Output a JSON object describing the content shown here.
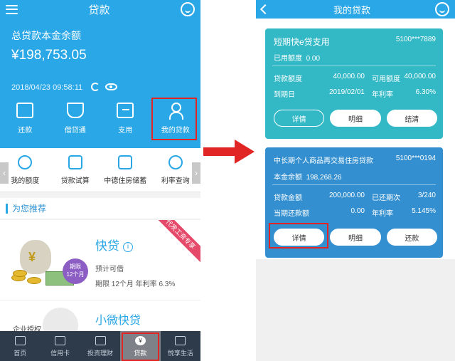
{
  "left": {
    "header": {
      "title": "贷款"
    },
    "summary": {
      "label": "总贷款本金余额",
      "amount": "¥198,753.05",
      "timestamp": "2018/04/23 09:58:11"
    },
    "actions": [
      {
        "label": "还款",
        "icon": "repay-icon"
      },
      {
        "label": "借贷通",
        "icon": "hand-money-icon"
      },
      {
        "label": "支用",
        "icon": "withdraw-icon"
      },
      {
        "label": "我的贷款",
        "icon": "user-loan-icon"
      }
    ],
    "quick": [
      {
        "label": "我的额度"
      },
      {
        "label": "贷款试算"
      },
      {
        "label": "中德住房储蓄"
      },
      {
        "label": "利率查询"
      }
    ],
    "recommend": {
      "title": "为您推荐"
    },
    "product1": {
      "title": "快贷",
      "subtitle": "预计可借",
      "term": "期限 12个月  年利率 6.3%",
      "badge_line1": "期限",
      "badge_line2": "12个月",
      "ribbon": "代发工资专享",
      "bag_symbol": "¥"
    },
    "product2": {
      "title": "小微快贷",
      "subtitle": "企业授权"
    },
    "tabs": [
      {
        "label": "首页"
      },
      {
        "label": "信用卡"
      },
      {
        "label": "投资理财"
      },
      {
        "label": "贷款",
        "icon_glyph": "¥"
      },
      {
        "label": "悦享生活"
      }
    ]
  },
  "right": {
    "header": {
      "title": "我的贷款"
    },
    "loan1": {
      "name": "短期快e贷支用",
      "account": "5100***7889",
      "used_label": "已用额度",
      "used_value": "0.00",
      "r1": {
        "l1": "贷款额度",
        "v1": "40,000.00",
        "l2": "可用额度",
        "v2": "40,000.00"
      },
      "r2": {
        "l1": "到期日",
        "v1": "2019/02/01",
        "l2": "年利率",
        "v2": "6.30%"
      },
      "buttons": [
        "详情",
        "明细",
        "结清"
      ]
    },
    "loan2": {
      "name": "中长期个人商品再交易住房贷款",
      "account": "5100***0194",
      "balance_label": "本金余额",
      "balance_value": "198,268.26",
      "r1": {
        "l1": "贷款金额",
        "v1": "200,000.00",
        "l2": "已还期次",
        "v2": "3/240"
      },
      "r2": {
        "l1": "当期还款额",
        "v1": "0.00",
        "l2": "年利率",
        "v2": "5.145%"
      },
      "buttons": [
        "详情",
        "明细",
        "还款"
      ]
    }
  },
  "colors": {
    "primary": "#2aa7e6",
    "card1": "#33b9c6",
    "card2": "#338fcf",
    "highlight": "#e12424",
    "tabbar": "#2d3b4a"
  }
}
